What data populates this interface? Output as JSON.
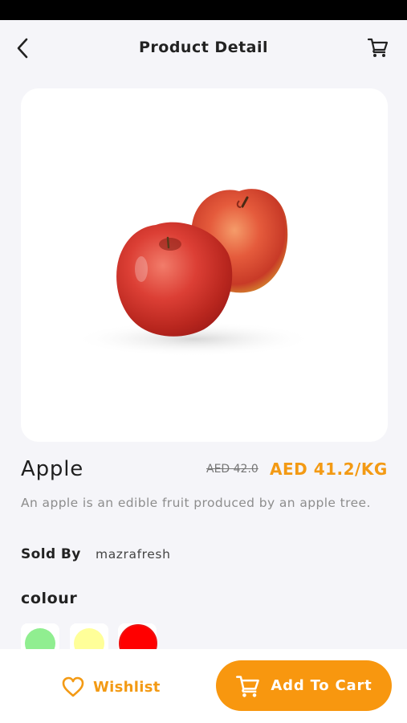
{
  "header": {
    "title": "Product Detail",
    "back_icon": "chevron-left-icon",
    "cart_icon": "shopping-cart-icon"
  },
  "product": {
    "image_alt": "two red apples",
    "name": "Apple",
    "old_price": "AED 42.0",
    "new_price": "AED 41.2/KG",
    "description": "An apple is an edible fruit produced by an apple tree.",
    "sold_by_label": "Sold By",
    "sold_by_value": "mazrafresh"
  },
  "colour": {
    "label": "colour",
    "options": [
      {
        "color": "#90ee90",
        "selected": false
      },
      {
        "color": "#ffff99",
        "selected": false
      },
      {
        "color": "#ff0000",
        "selected": true
      }
    ]
  },
  "actions": {
    "wishlist_label": "Wishlist",
    "wishlist_icon": "heart-outline-icon",
    "add_to_cart_label": "Add To Cart",
    "add_to_cart_icon": "shopping-cart-icon"
  },
  "theme": {
    "accent": "#f8970f",
    "background": "#f5f5f9"
  }
}
